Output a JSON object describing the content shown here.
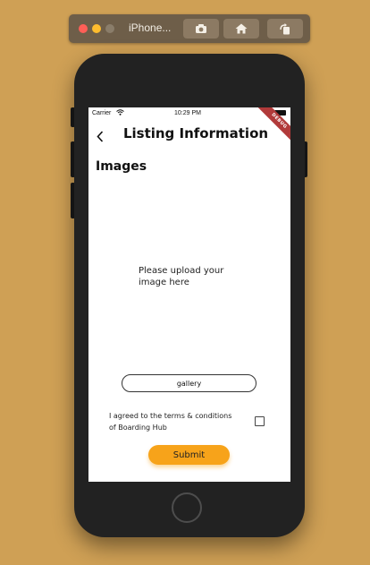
{
  "simulator": {
    "title": "iPhone..."
  },
  "status_bar": {
    "carrier": "Carrier",
    "time": "10:29 PM"
  },
  "debug_banner": "DEBUG",
  "nav": {
    "title": "Listing Information"
  },
  "images_section": {
    "title": "Images",
    "placeholder": "Please upload your image here"
  },
  "buttons": {
    "gallery": "gallery",
    "submit": "Submit"
  },
  "terms": {
    "label": "I agreed to the terms & conditions of Boarding Hub",
    "checked": false
  },
  "colors": {
    "background": "#cfa055",
    "submit": "#f7a31a",
    "debug_banner": "#b13a3a"
  },
  "icons": {
    "back": "chevron-left-icon",
    "wifi": "wifi-icon",
    "battery": "battery-icon",
    "screenshot": "camera-icon",
    "home": "home-icon",
    "rotate": "rotate-icon"
  }
}
